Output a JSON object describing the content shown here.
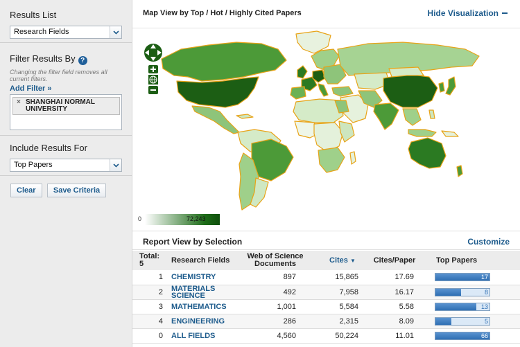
{
  "sidebar": {
    "results_list": {
      "heading": "Results List",
      "selected": "Research Fields"
    },
    "filter": {
      "heading": "Filter Results By",
      "note": "Changing the filter field removes all current filters.",
      "add_filter": "Add Filter »",
      "chips": [
        "SHANGHAI NORMAL UNIVERSITY"
      ]
    },
    "include": {
      "heading": "Include Results For",
      "selected": "Top Papers"
    },
    "buttons": {
      "clear": "Clear",
      "save": "Save Criteria"
    }
  },
  "map": {
    "title": "Map View by Top / Hot / Highly Cited Papers",
    "hide_label": "Hide Visualization",
    "legend_min": "0",
    "legend_max": "72,243"
  },
  "report": {
    "title": "Report View by Selection",
    "customize": "Customize",
    "headers": {
      "total": "Total: 5",
      "field": "Research Fields",
      "docs": "Web of Science Documents",
      "cites": "Cites",
      "cpp": "Cites/Paper",
      "top": "Top Papers"
    },
    "rows": [
      {
        "rank": "1",
        "field": "CHEMISTRY",
        "docs": "897",
        "cites": "15,865",
        "cpp": "17.69",
        "top": "17",
        "top_frac": 1.0
      },
      {
        "rank": "2",
        "field": "MATERIALS SCIENCE",
        "docs": "492",
        "cites": "7,958",
        "cpp": "16.17",
        "top": "8",
        "top_frac": 0.47
      },
      {
        "rank": "3",
        "field": "MATHEMATICS",
        "docs": "1,001",
        "cites": "5,584",
        "cpp": "5.58",
        "top": "13",
        "top_frac": 0.76
      },
      {
        "rank": "4",
        "field": "ENGINEERING",
        "docs": "286",
        "cites": "2,315",
        "cpp": "8.09",
        "top": "5",
        "top_frac": 0.29
      },
      {
        "rank": "0",
        "field": "ALL FIELDS",
        "docs": "4,560",
        "cites": "50,224",
        "cpp": "11.01",
        "top": "66",
        "top_frac": 1.0
      }
    ]
  },
  "colors": {
    "accent": "#1d5b8c",
    "map_dark": "#1c5e14",
    "map_border": "#e8a317",
    "bar_fill": "#2f6fb3"
  }
}
